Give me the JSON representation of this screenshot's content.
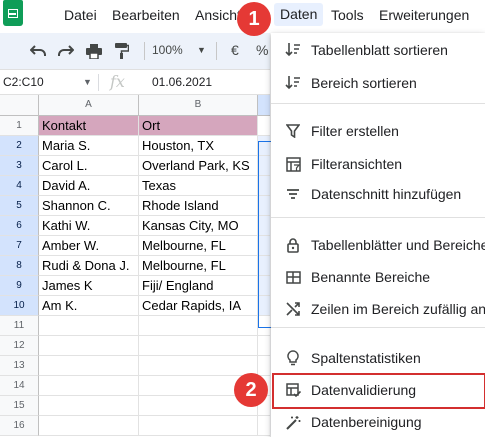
{
  "menubar": {
    "items": [
      "Datei",
      "Bearbeiten",
      "Ansicht",
      "Daten",
      "Tools",
      "Erweiterungen"
    ]
  },
  "toolbar": {
    "zoom": "100%",
    "currency": "€",
    "percent": "%"
  },
  "formula_bar": {
    "name_box": "C2:C10",
    "fx": "fx",
    "value": "01.06.2021"
  },
  "grid": {
    "columns": [
      "A",
      "B"
    ],
    "row_numbers": [
      "1",
      "2",
      "3",
      "4",
      "5",
      "6",
      "7",
      "8",
      "9",
      "10",
      "11",
      "12",
      "13",
      "14",
      "15",
      "16"
    ],
    "rows": [
      [
        "Kontakt",
        "Ort"
      ],
      [
        "Maria S.",
        "Houston, TX"
      ],
      [
        "Carol L.",
        "Overland Park, KS"
      ],
      [
        "David A.",
        "Texas"
      ],
      [
        "Shannon C.",
        "Rhode Island"
      ],
      [
        "Kathi W.",
        "Kansas City, MO"
      ],
      [
        "Amber W.",
        "Melbourne, FL"
      ],
      [
        "Rudi & Dona J.",
        "Melbourne, FL"
      ],
      [
        "James K",
        "Fiji/ England"
      ],
      [
        "Am K.",
        "Cedar Rapids, IA"
      ]
    ],
    "header_color": "#d5a6bd"
  },
  "data_menu": {
    "items": [
      {
        "label": "Tabellenblatt sortieren",
        "icon": "sort-icon"
      },
      {
        "label": "Bereich sortieren",
        "icon": "sort-range-icon"
      },
      {
        "label": "Filter erstellen",
        "icon": "filter-icon"
      },
      {
        "label": "Filteransichten",
        "icon": "filter-views-icon"
      },
      {
        "label": "Datenschnitt hinzufügen",
        "icon": "slicer-icon"
      },
      {
        "label": "Tabellenblätter und Bereiche schützen",
        "icon": "lock-icon"
      },
      {
        "label": "Benannte Bereiche",
        "icon": "named-ranges-icon"
      },
      {
        "label": "Zeilen im Bereich zufällig anordnen",
        "icon": "shuffle-icon"
      },
      {
        "label": "Spaltenstatistiken",
        "icon": "lightbulb-icon"
      },
      {
        "label": "Datenvalidierung",
        "icon": "data-validation-icon"
      },
      {
        "label": "Datenbereinigung",
        "icon": "magic-wand-icon"
      }
    ]
  },
  "callouts": [
    "1",
    "2"
  ],
  "colors": {
    "callout": "#e53935",
    "highlight_border": "#d32f2f",
    "active_menu": "#e8f0fe",
    "sheets_green": "#0f9d58"
  }
}
